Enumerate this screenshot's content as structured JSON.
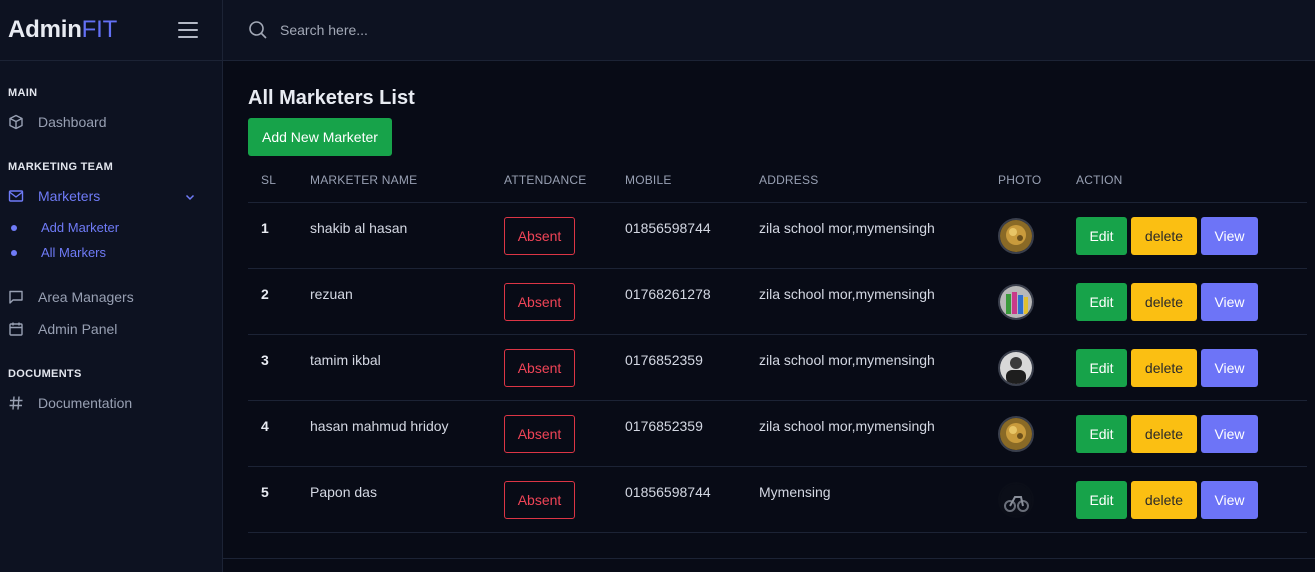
{
  "brand": {
    "part1": "Admin",
    "part2": "FIT"
  },
  "sidebar": {
    "sections": {
      "main": "MAIN",
      "team": "MARKETING TEAM",
      "docs": "DOCUMENTS"
    },
    "items": {
      "dashboard": "Dashboard",
      "marketers": "Marketers",
      "add_marketer": "Add Marketer",
      "all_markers": "All Markers",
      "area_managers": "Area Managers",
      "admin_panel": "Admin Panel",
      "documentation": "Documentation"
    }
  },
  "search": {
    "placeholder": "Search here..."
  },
  "page": {
    "title": "All Marketers List",
    "add_button": "Add New Marketer"
  },
  "table": {
    "headers": {
      "sl": "SL",
      "name": "MARKETER NAME",
      "attendance": "ATTENDANCE",
      "mobile": "MOBILE",
      "address": "ADDRESS",
      "photo": "PHOTO",
      "action": "ACTION"
    },
    "rows": [
      {
        "sl": "1",
        "name": "shakib al hasan",
        "attendance": "Absent",
        "mobile": "01856598744",
        "address": "zila school mor,mymensingh",
        "edit": "Edit",
        "delete": "delete",
        "view": "View"
      },
      {
        "sl": "2",
        "name": "rezuan",
        "attendance": "Absent",
        "mobile": "01768261278",
        "address": "zila school mor,mymensingh",
        "edit": "Edit",
        "delete": "delete",
        "view": "View"
      },
      {
        "sl": "3",
        "name": "tamim ikbal",
        "attendance": "Absent",
        "mobile": "0176852359",
        "address": "zila school mor,mymensingh",
        "edit": "Edit",
        "delete": "delete",
        "view": "View"
      },
      {
        "sl": "4",
        "name": "hasan mahmud hridoy",
        "attendance": "Absent",
        "mobile": "0176852359",
        "address": "zila school mor,mymensingh",
        "edit": "Edit",
        "delete": "delete",
        "view": "View"
      },
      {
        "sl": "5",
        "name": "Papon das",
        "attendance": "Absent",
        "mobile": "01856598744",
        "address": "Mymensing",
        "edit": "Edit",
        "delete": "delete",
        "view": "View"
      }
    ]
  },
  "colors": {
    "accent": "#6f7bf7",
    "success": "#17a34a",
    "warning": "#fbbf12",
    "danger": "#dc3545",
    "info": "#6d74f7",
    "background": "#080b16"
  }
}
